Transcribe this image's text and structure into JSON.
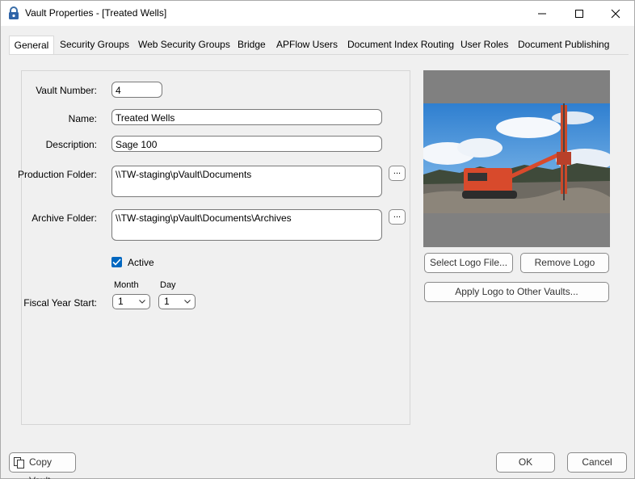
{
  "window": {
    "title": "Vault Properties - [Treated Wells]"
  },
  "tabs": [
    {
      "label": "General"
    },
    {
      "label": "Security Groups"
    },
    {
      "label": "Web Security Groups"
    },
    {
      "label": "Bridge"
    },
    {
      "label": "APFlow Users"
    },
    {
      "label": "Document Index Routing"
    },
    {
      "label": "User Roles"
    },
    {
      "label": "Document Publishing"
    }
  ],
  "form": {
    "vault_number_label": "Vault Number:",
    "vault_number_value": "4",
    "name_label": "Name:",
    "name_value": "Treated Wells",
    "description_label": "Description:",
    "description_value": "Sage 100",
    "production_folder_label": "Production Folder:",
    "production_folder_value": "\\\\TW-staging\\pVault\\Documents",
    "archive_folder_label": "Archive Folder:",
    "archive_folder_value": "\\\\TW-staging\\pVault\\Documents\\Archives",
    "browse_label": "...",
    "active_label": "Active",
    "active_checked": true,
    "fiscal_year_label": "Fiscal Year Start:",
    "month_label": "Month",
    "month_value": "1",
    "day_label": "Day",
    "day_value": "1"
  },
  "logo": {
    "select_button": "Select Logo File...",
    "remove_button": "Remove Logo",
    "apply_button": "Apply Logo to Other Vaults..."
  },
  "footer": {
    "copy_vault_button": "Copy Vault",
    "ok_button": "OK",
    "cancel_button": "Cancel"
  },
  "colors": {
    "accent": "#0067c0",
    "logo_background": "#808080"
  }
}
